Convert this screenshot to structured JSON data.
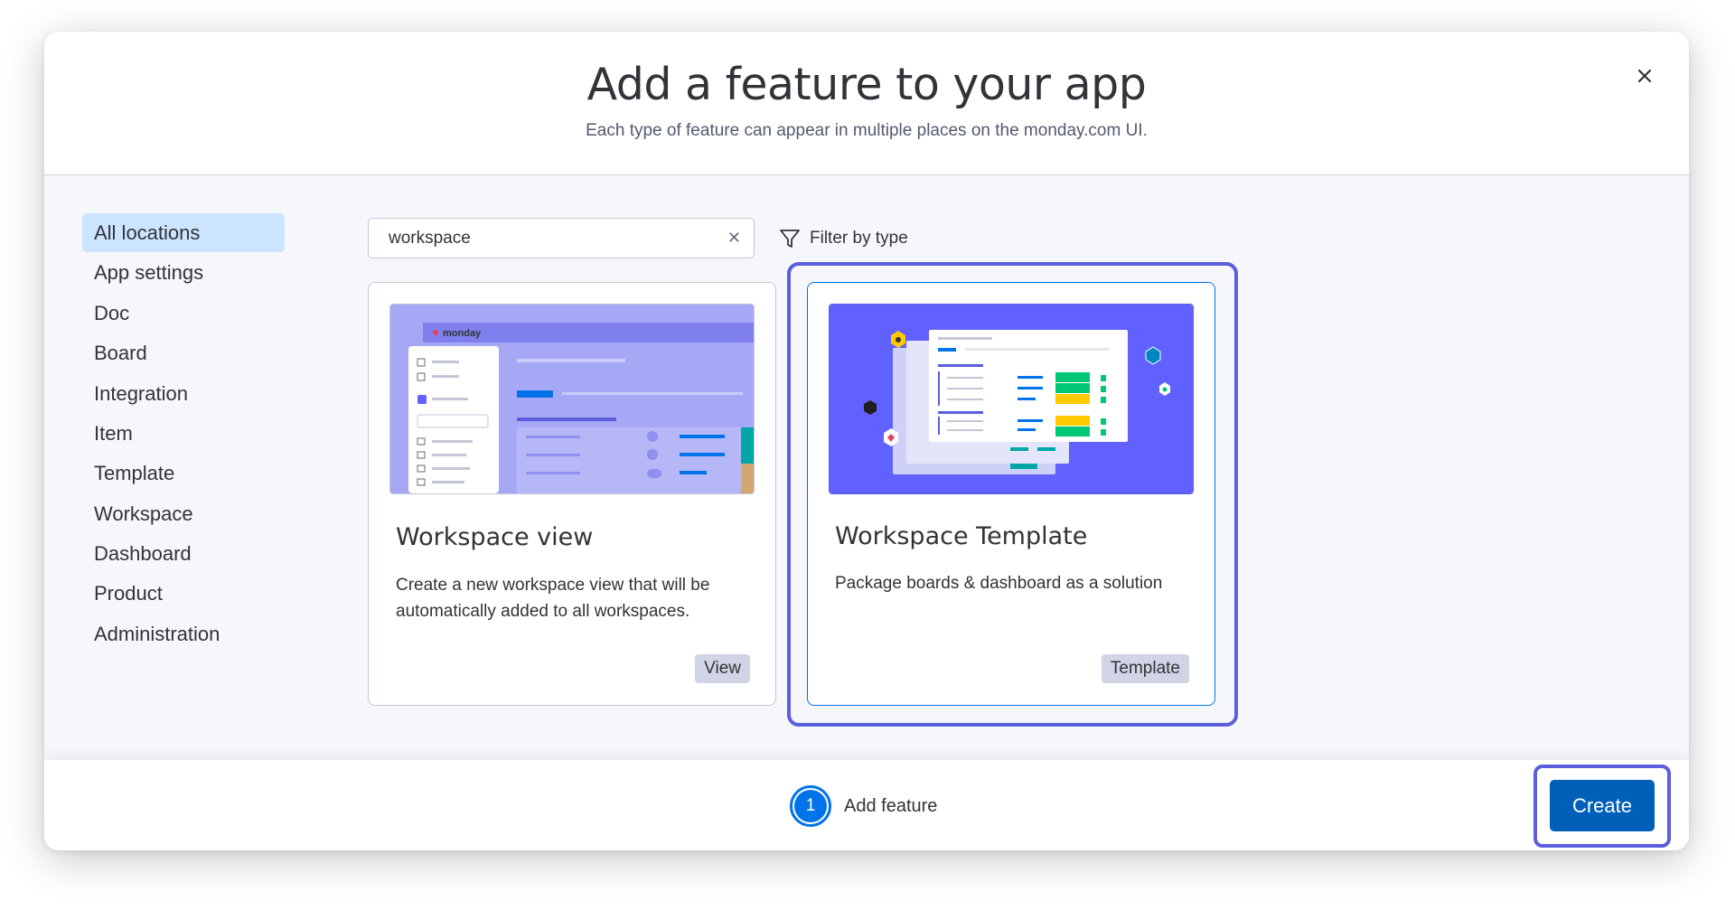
{
  "header": {
    "title": "Add a feature to your app",
    "subtitle": "Each type of feature can appear in multiple places on the monday.com UI.",
    "close_icon": "close-icon"
  },
  "sidebar": {
    "items": [
      {
        "label": "All locations",
        "active": true
      },
      {
        "label": "App settings"
      },
      {
        "label": "Doc"
      },
      {
        "label": "Board"
      },
      {
        "label": "Integration"
      },
      {
        "label": "Item"
      },
      {
        "label": "Template"
      },
      {
        "label": "Workspace"
      },
      {
        "label": "Dashboard"
      },
      {
        "label": "Product"
      },
      {
        "label": "Administration"
      }
    ]
  },
  "search": {
    "value": "workspace",
    "clear_icon": "clear-icon"
  },
  "filter": {
    "label": "Filter by type",
    "icon": "filter-icon"
  },
  "cards": [
    {
      "title": "Workspace view",
      "description": "Create a new workspace view that will be automatically added to all workspaces.",
      "tag": "View",
      "thumb_logo": "monday"
    },
    {
      "title": "Workspace Template",
      "description": "Package boards & dashboard as a solution",
      "tag": "Template",
      "selected": true
    }
  ],
  "footer": {
    "step_number": "1",
    "step_label": "Add feature",
    "create_label": "Create"
  },
  "colors": {
    "primary": "#0073ea",
    "focus_ring": "#5b5fde",
    "active_sidebar": "#cce5ff",
    "template_thumb_bg": "#6161ff"
  }
}
